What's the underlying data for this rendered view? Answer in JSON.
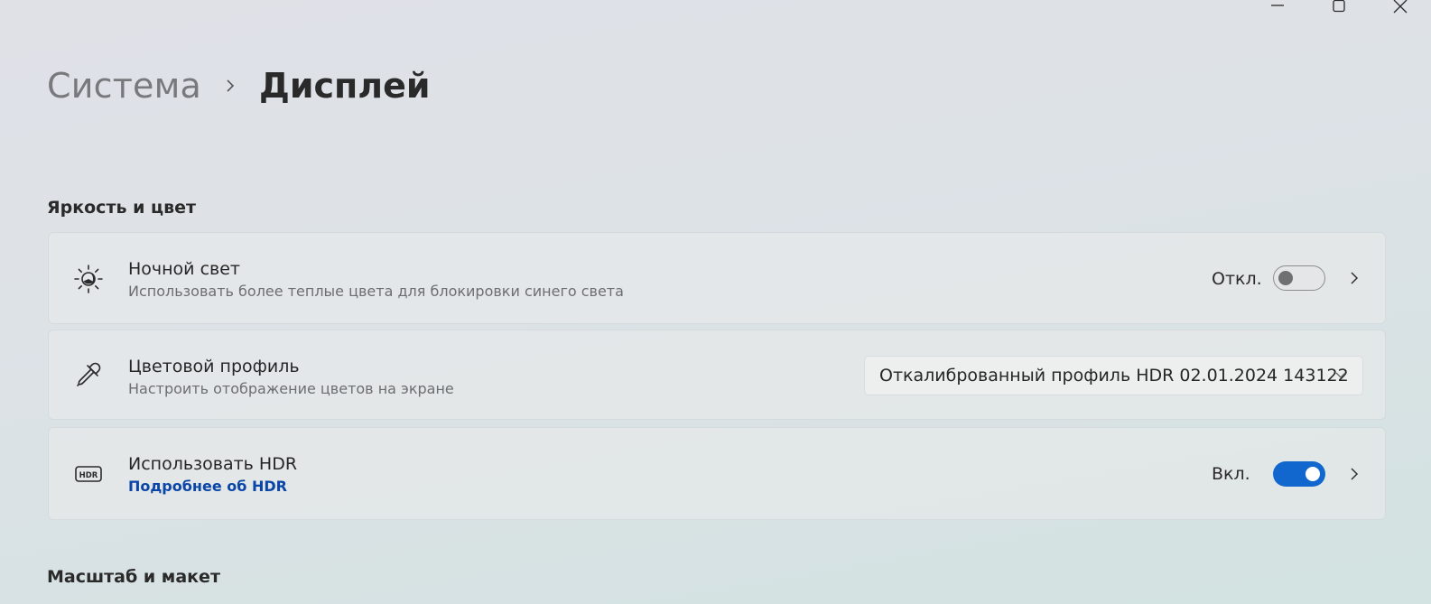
{
  "window": {
    "controls": [
      {
        "name": "minimize",
        "icon": "minimize-icon"
      },
      {
        "name": "maximize",
        "icon": "maximize-icon"
      },
      {
        "name": "close",
        "icon": "close-icon"
      }
    ]
  },
  "breadcrumb": {
    "parent": "Система",
    "current": "Дисплей"
  },
  "sections": {
    "brightness": {
      "title": "Яркость и цвет"
    },
    "scale": {
      "title": "Масштаб и макет"
    }
  },
  "settings": {
    "night_light": {
      "icon": "night-light-icon",
      "title": "Ночной свет",
      "subtitle": "Использовать более теплые цвета для блокировки синего света",
      "state_label": "Откл.",
      "enabled": false
    },
    "color_profile": {
      "icon": "eyedropper-icon",
      "title": "Цветовой профиль",
      "subtitle": "Настроить отображение цветов на экране",
      "selected": "Откалиброванный профиль HDR 02.01.2024 143122"
    },
    "hdr": {
      "icon": "hdr-icon",
      "title": "Использовать HDR",
      "link": "Подробнее об HDR",
      "state_label": "Вкл.",
      "enabled": true
    }
  },
  "colors": {
    "accent": "#1267cf",
    "link": "#0a46a8"
  }
}
